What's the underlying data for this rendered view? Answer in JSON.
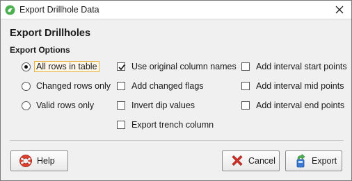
{
  "window": {
    "title": "Export Drillhole Data"
  },
  "heading": "Export Drillholes",
  "export_options": {
    "group_label": "Export Options",
    "rows_radio": [
      {
        "label": "All rows in table",
        "selected": true
      },
      {
        "label": "Changed rows only",
        "selected": false
      },
      {
        "label": "Valid rows only",
        "selected": false
      }
    ],
    "column_checks": [
      {
        "label": "Use original column names",
        "checked": true
      },
      {
        "label": "Add changed flags",
        "checked": false
      },
      {
        "label": "Invert dip values",
        "checked": false
      },
      {
        "label": "Export trench column",
        "checked": false
      }
    ],
    "interval_checks": [
      {
        "label": "Add interval start points",
        "checked": false
      },
      {
        "label": "Add interval mid points",
        "checked": false
      },
      {
        "label": "Add interval end points",
        "checked": false
      }
    ]
  },
  "buttons": {
    "help": "Help",
    "cancel": "Cancel",
    "export": "Export"
  },
  "icons": {
    "app": "leapfrog-app-icon",
    "close": "close-icon",
    "help": "lifebuoy-icon",
    "cancel": "red-x-icon",
    "export": "export-icon"
  },
  "colors": {
    "focus_border": "#e8b040",
    "app_icon_green": "#4caf50",
    "cancel_red": "#d9342b",
    "help_red": "#e04030"
  }
}
